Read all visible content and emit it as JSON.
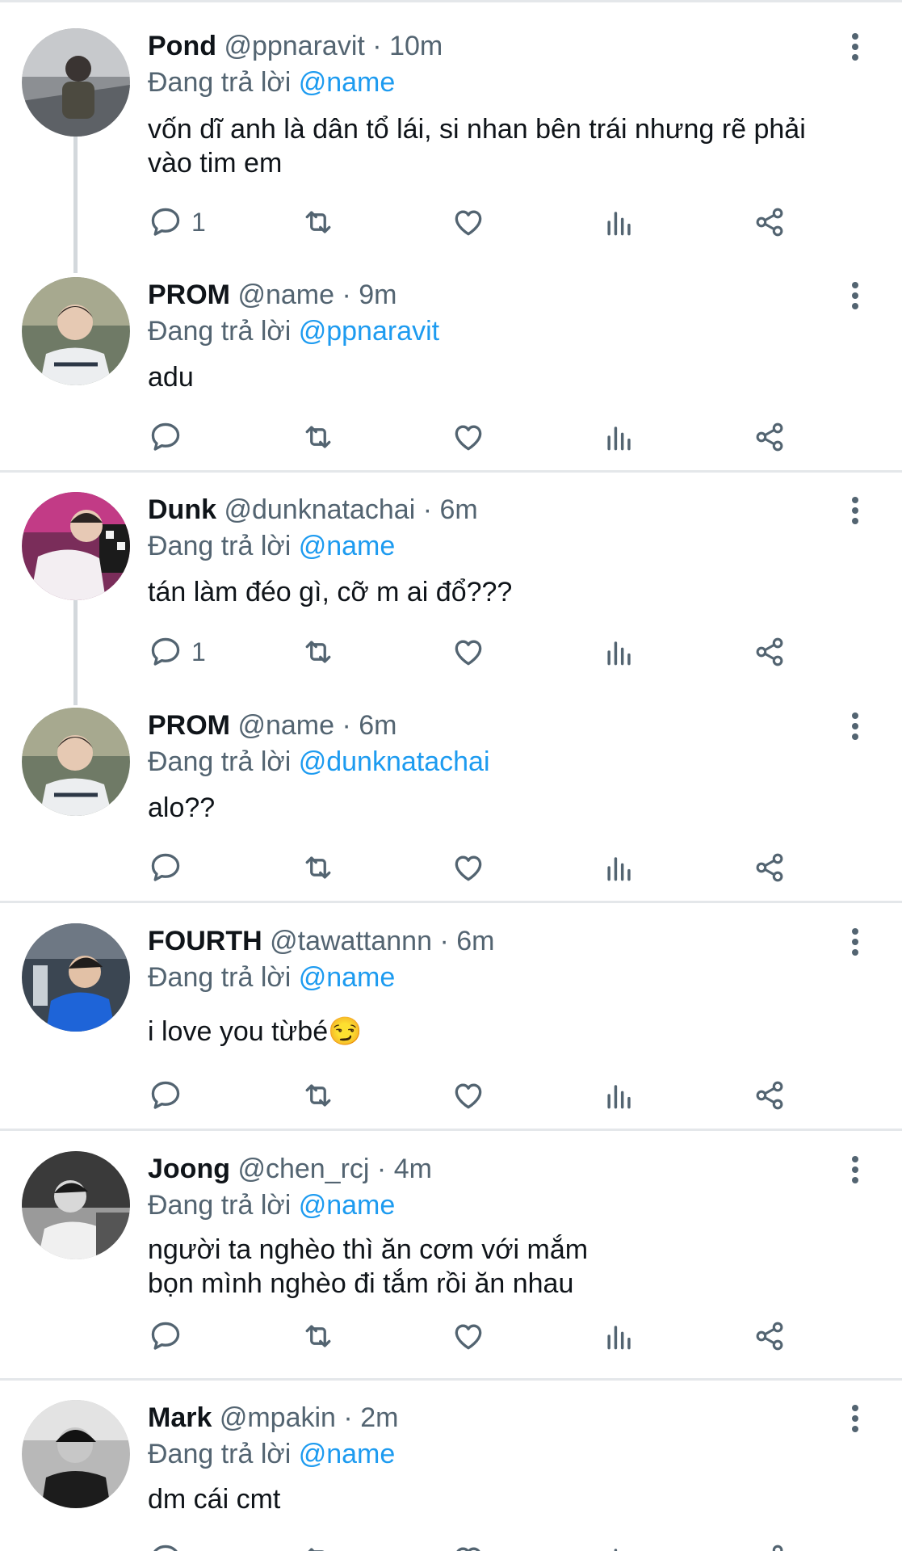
{
  "reply_prefix": "Đang trả lời",
  "tweets": [
    {
      "name": "Pond",
      "handle": "@ppnaravit",
      "time": "10m",
      "reply_to": "@name",
      "text": "vốn dĩ anh là dân tổ lái, si nhan bên trái nhưng rẽ phải\nvào tim em",
      "reply_count": "1"
    },
    {
      "name": "PROM",
      "handle": "@name",
      "time": "9m",
      "reply_to": "@ppnaravit",
      "text": "adu",
      "reply_count": ""
    },
    {
      "name": "Dunk",
      "handle": "@dunknatachai",
      "time": "6m",
      "reply_to": "@name",
      "text": "tán làm đéo gì, cỡ m ai đổ???",
      "reply_count": "1"
    },
    {
      "name": "PROM",
      "handle": "@name",
      "time": "6m",
      "reply_to": "@dunknatachai",
      "text": "alo??",
      "reply_count": ""
    },
    {
      "name": "FOURTH",
      "handle": "@tawattannn",
      "time": "6m",
      "reply_to": "@name",
      "text": "i love you từbé😏",
      "reply_count": ""
    },
    {
      "name": "Joong",
      "handle": "@chen_rcj",
      "time": "4m",
      "reply_to": "@name",
      "text": "người ta nghèo thì ăn cơm với mắm\nbọn mình nghèo đi tắm rồi ăn nhau",
      "reply_count": ""
    },
    {
      "name": "Mark",
      "handle": "@mpakin",
      "time": "2m",
      "reply_to": "@name",
      "text": "dm cái cmt",
      "reply_count": ""
    }
  ],
  "colors": {
    "link": "#1d9bf0",
    "muted": "#536471",
    "text": "#0f1419",
    "divider": "#e4e7ea"
  },
  "icons": {
    "reply": "reply-icon",
    "retweet": "retweet-icon",
    "like": "heart-icon",
    "views": "views-icon",
    "share": "share-icon",
    "more": "more-vertical-icon"
  }
}
